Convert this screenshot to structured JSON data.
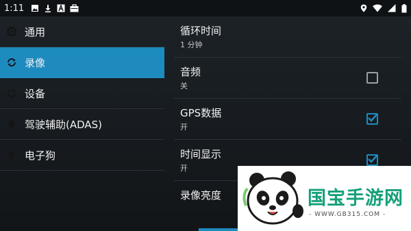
{
  "status_bar": {
    "time": "1:11",
    "left_icons": [
      "image-icon",
      "download-icon",
      "font-icon",
      "briefcase-icon"
    ],
    "right_icons": [
      "location-icon",
      "wifi-icon",
      "signal-icon",
      "battery-icon"
    ]
  },
  "sidebar": {
    "items": [
      {
        "label": "通用",
        "icon": "settings-icon",
        "active": false
      },
      {
        "label": "录像",
        "icon": "sync-icon",
        "active": true
      },
      {
        "label": "设备",
        "icon": "sync-icon",
        "active": false
      },
      {
        "label": "驾驶辅助(ADAS)",
        "icon": "bell-icon",
        "active": false
      },
      {
        "label": "电子狗",
        "icon": "bell-icon",
        "active": false
      }
    ]
  },
  "settings": [
    {
      "title": "循环时间",
      "summary": "1 分钟",
      "checkbox": null
    },
    {
      "title": "音频",
      "summary": "关",
      "checkbox": false
    },
    {
      "title": "GPS数据",
      "summary": "开",
      "checkbox": true
    },
    {
      "title": "时间显示",
      "summary": "开",
      "checkbox": true
    },
    {
      "title": "录像亮度",
      "summary": "",
      "checkbox": null
    }
  ],
  "watermark": {
    "title": "国宝手游网",
    "url": "- WWW.GB315.COM -"
  },
  "colors": {
    "accent": "#1e8bbf",
    "background": "#15191d",
    "watermark_green": "#15a07a"
  }
}
